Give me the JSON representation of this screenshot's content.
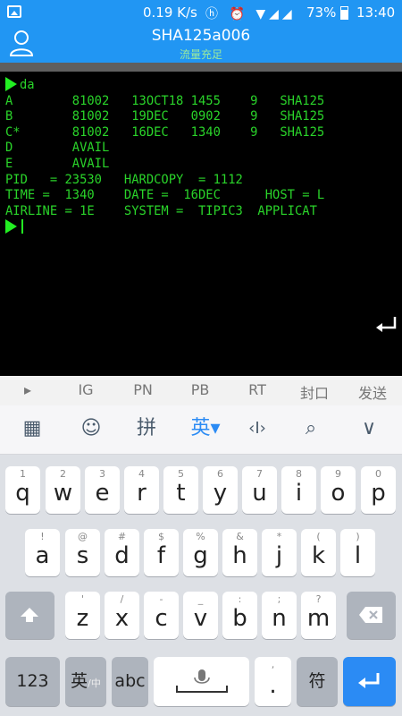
{
  "status_bar": {
    "speed": "0.19 K/s",
    "icons": "ⓗ ⏰ ▼◢◢",
    "battery_pct": "73%",
    "time": "13:40"
  },
  "app_bar": {
    "title": "SHA125a006",
    "subtitle": "流量充足"
  },
  "terminal": {
    "command": "da",
    "lines": [
      "A        81002   13OCT18 1455    9   SHA125",
      "B        81002   19DEC   0902    9   SHA125",
      "C*       81002   16DEC   1340    9   SHA125",
      "D        AVAIL",
      "E        AVAIL",
      "PID   = 23530   HARDCOPY  = 1112",
      "TIME =  1340    DATE =  16DEC      HOST = L",
      "AIRLINE = 1E    SYSTEM =  TIPIC3  APPLICAT"
    ]
  },
  "shortcut_bar": {
    "items": [
      "▸",
      "IG",
      "PN",
      "PB",
      "RT",
      "封口",
      "发送"
    ]
  },
  "keyboard": {
    "toolbar": {
      "grid": "▦",
      "emoji": "☺",
      "pinyin": "拼",
      "english": "英▾",
      "cursor": "‹I›",
      "search": "⌕",
      "collapse": "∨"
    },
    "row1": [
      {
        "main": "q",
        "sup": "1"
      },
      {
        "main": "w",
        "sup": "2"
      },
      {
        "main": "e",
        "sup": "3"
      },
      {
        "main": "r",
        "sup": "4"
      },
      {
        "main": "t",
        "sup": "5"
      },
      {
        "main": "y",
        "sup": "6"
      },
      {
        "main": "u",
        "sup": "7"
      },
      {
        "main": "i",
        "sup": "8"
      },
      {
        "main": "o",
        "sup": "9"
      },
      {
        "main": "p",
        "sup": "0"
      }
    ],
    "row2": [
      {
        "main": "a",
        "sup": "!"
      },
      {
        "main": "s",
        "sup": "@"
      },
      {
        "main": "d",
        "sup": "#"
      },
      {
        "main": "f",
        "sup": "$"
      },
      {
        "main": "g",
        "sup": "%"
      },
      {
        "main": "h",
        "sup": "&"
      },
      {
        "main": "j",
        "sup": "*"
      },
      {
        "main": "k",
        "sup": "("
      },
      {
        "main": "l",
        "sup": ")"
      }
    ],
    "row3": [
      {
        "main": "z",
        "sup": "'"
      },
      {
        "main": "x",
        "sup": "/"
      },
      {
        "main": "c",
        "sup": "-"
      },
      {
        "main": "v",
        "sup": "_"
      },
      {
        "main": "b",
        "sup": ":"
      },
      {
        "main": "n",
        "sup": ";"
      },
      {
        "main": "m",
        "sup": "?"
      }
    ],
    "bottom": {
      "num": "123",
      "lang_main": "英",
      "lang_sub": "/中",
      "abc": "abc",
      "period": ".",
      "period_sup": ",",
      "symbol": "符"
    }
  }
}
